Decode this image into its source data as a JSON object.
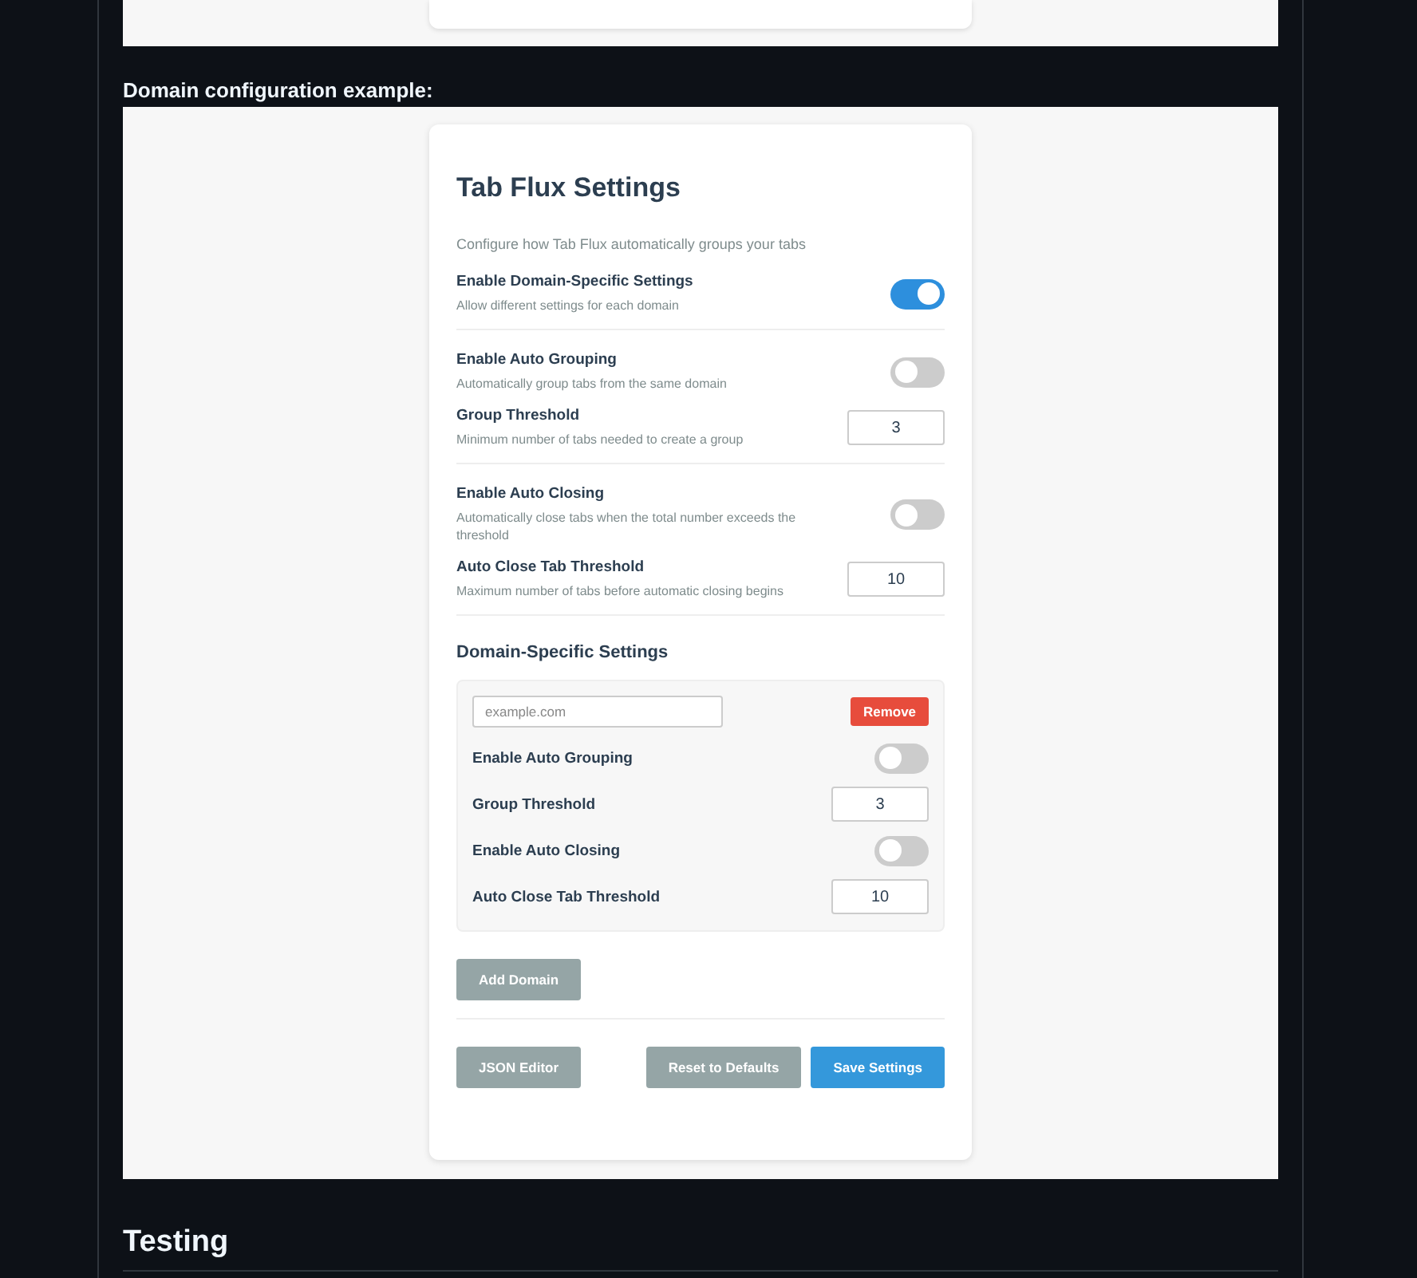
{
  "caption": "Domain configuration example:",
  "settings": {
    "title": "Tab Flux Settings",
    "description": "Configure how Tab Flux automatically groups your tabs",
    "sections": [
      {
        "items": [
          {
            "kind": "toggle",
            "label": "Enable Domain-Specific Settings",
            "hint": "Allow different settings for each domain",
            "on": true
          }
        ]
      },
      {
        "items": [
          {
            "kind": "toggle",
            "label": "Enable Auto Grouping",
            "hint": "Automatically group tabs from the same domain",
            "on": false
          },
          {
            "kind": "number",
            "label": "Group Threshold",
            "hint": "Minimum number of tabs needed to create a group",
            "value": "3"
          }
        ]
      },
      {
        "items": [
          {
            "kind": "toggle",
            "label": "Enable Auto Closing",
            "hint": "Automatically close tabs when the total number exceeds the threshold",
            "on": false
          },
          {
            "kind": "number",
            "label": "Auto Close Tab Threshold",
            "hint": "Maximum number of tabs before automatic closing begins",
            "value": "10"
          }
        ]
      }
    ],
    "domain_heading": "Domain-Specific Settings",
    "domains": [
      {
        "placeholder": "example.com",
        "remove_label": "Remove",
        "items": [
          {
            "kind": "toggle",
            "label": "Enable Auto Grouping",
            "on": false
          },
          {
            "kind": "number",
            "label": "Group Threshold",
            "value": "3"
          },
          {
            "kind": "toggle",
            "label": "Enable Auto Closing",
            "on": false
          },
          {
            "kind": "number",
            "label": "Auto Close Tab Threshold",
            "value": "10"
          }
        ]
      }
    ],
    "add_domain_label": "Add Domain",
    "buttons": [
      {
        "label": "JSON Editor",
        "kind": "secondary"
      },
      {
        "label": "Reset to Defaults",
        "kind": "secondary"
      },
      {
        "label": "Save Settings",
        "kind": "primary"
      }
    ]
  },
  "next_heading": "Testing"
}
